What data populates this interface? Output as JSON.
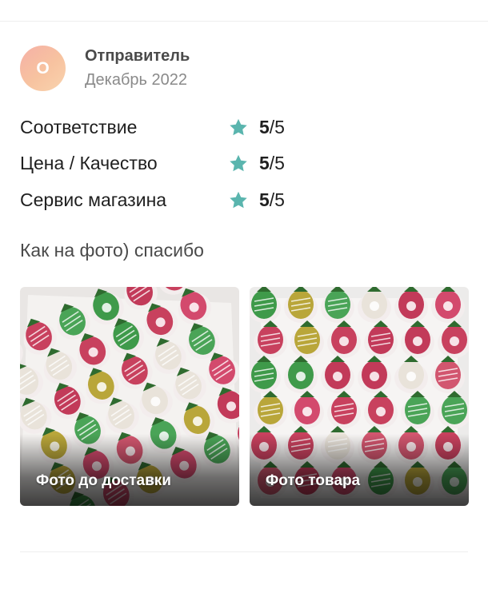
{
  "review": {
    "avatar_letter": "О",
    "sender": "Отправитель",
    "date": "Декабрь 2022",
    "ratings": [
      {
        "label": "Соответствие",
        "score": "5",
        "max": "/5"
      },
      {
        "label": "Цена / Качество",
        "score": "5",
        "max": "/5"
      },
      {
        "label": "Сервис магазина",
        "score": "5",
        "max": "/5"
      }
    ],
    "text": "Как на фото) спасибо",
    "photos": [
      {
        "caption": "Фото до доставки"
      },
      {
        "caption": "Фото товара"
      }
    ]
  },
  "colors": {
    "star": "#5ab5ae",
    "avatar_gradient_start": "#f6b0a6",
    "avatar_gradient_end": "#f9d3ae"
  },
  "icons": {
    "rating_star": "star-icon"
  }
}
